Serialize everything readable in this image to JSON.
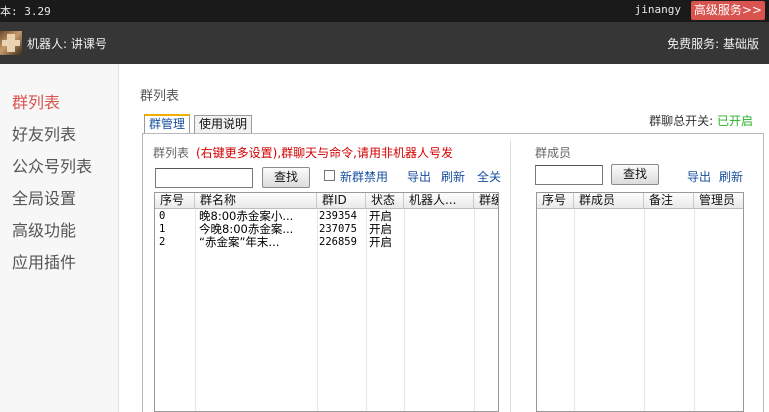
{
  "topbar": {
    "version": "本: 3.29",
    "username": "jinangy",
    "premium_label": "高级服务>>"
  },
  "header": {
    "robot_label": "机器人: 讲课号",
    "service_label": "免费服务: 基础版"
  },
  "sidebar": {
    "items": [
      {
        "label": "群列表",
        "active": true
      },
      {
        "label": "好友列表",
        "active": false
      },
      {
        "label": "公众号列表",
        "active": false
      },
      {
        "label": "全局设置",
        "active": false
      },
      {
        "label": "高级功能",
        "active": false
      },
      {
        "label": "应用插件",
        "active": false
      }
    ]
  },
  "main": {
    "title": "群列表",
    "switch_label": "群聊总开关:",
    "switch_value": "已开启",
    "tabs": [
      {
        "label": "群管理",
        "active": true
      },
      {
        "label": "使用说明",
        "active": false
      }
    ]
  },
  "group_panel": {
    "label": "群列表",
    "hint": "(右键更多设置),群聊天与命令,请用非机器人号发",
    "search_placeholder": "",
    "search_button": "查找",
    "new_group_ban_label": "新群禁用",
    "new_group_ban_checked": false,
    "export_link": "导出",
    "refresh_link": "刷新",
    "select_all_link": "全关",
    "columns": [
      "序号",
      "群名称",
      "群ID",
      "状态",
      "机器人...",
      "群缓"
    ],
    "rows": [
      {
        "index": "0",
        "name": "晚8:00赤金案小...",
        "id": "239354",
        "status": "开启",
        "robot": "",
        "extra": ""
      },
      {
        "index": "1",
        "name": "今晚8:00赤金案...",
        "id": "237075",
        "status": "开启",
        "robot": "",
        "extra": ""
      },
      {
        "index": "2",
        "name": "“赤金案”年末...",
        "id": "226859",
        "status": "开启",
        "robot": "",
        "extra": ""
      }
    ]
  },
  "member_panel": {
    "label": "群成员",
    "search_placeholder": "",
    "search_button": "查找",
    "export_link": "导出",
    "refresh_link": "刷新",
    "columns": [
      "序号",
      "群成员",
      "备注",
      "管理员"
    ]
  },
  "colors": {
    "accent_red": "#d9534f",
    "link_blue": "#1a4fa0",
    "enabled_green": "#2bb02b",
    "hint_red": "#d40000"
  }
}
